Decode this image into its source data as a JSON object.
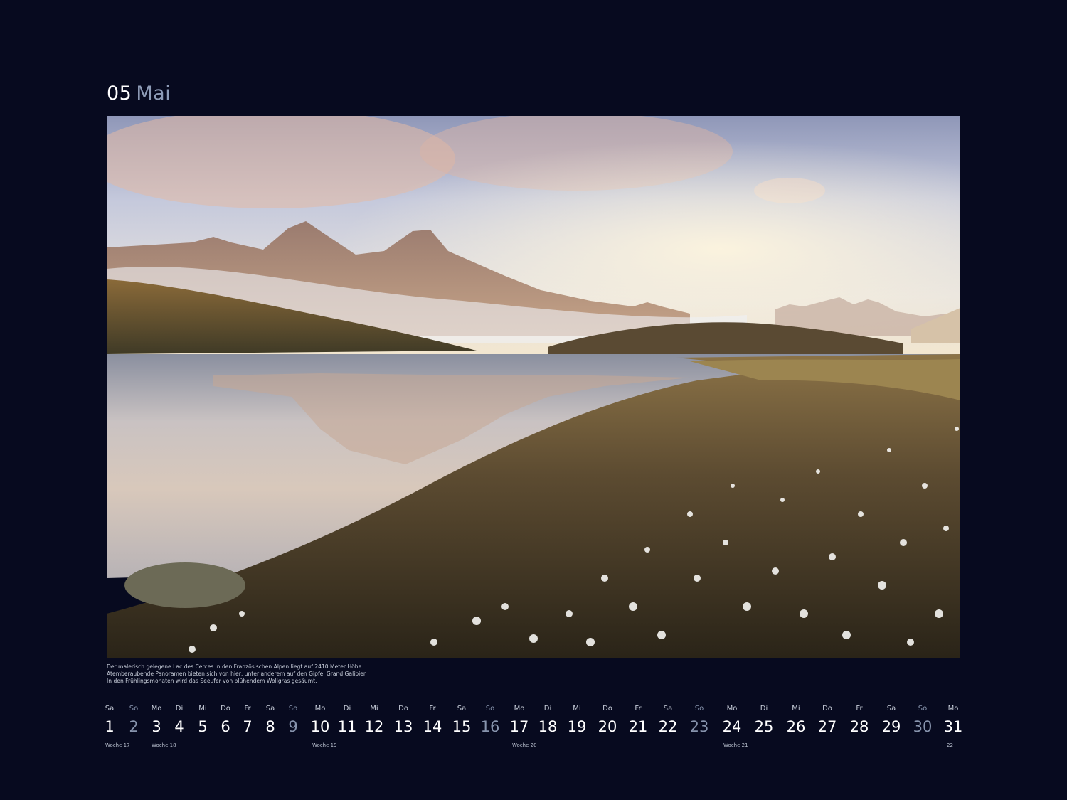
{
  "header": {
    "month_number": "05",
    "month_name": "Mai"
  },
  "photo": {
    "subject": "mountain-lake-landscape"
  },
  "caption": [
    "Der malerisch gelegene Lac des Cerces in den Französischen Alpen liegt auf 2410 Meter Höhe.",
    "Atemberaubende Panoramen bieten sich von hier, unter anderem auf den Gipfel Grand Galibier.",
    "In den Frühlingsmonaten wird das Seeufer von blühendem Wollgras gesäumt."
  ],
  "calendar": {
    "days": [
      {
        "dn": "Sa",
        "d": "1",
        "sun": false
      },
      {
        "dn": "So",
        "d": "2",
        "sun": true
      },
      {
        "dn": "Mo",
        "d": "3",
        "sun": false
      },
      {
        "dn": "Di",
        "d": "4",
        "sun": false
      },
      {
        "dn": "Mi",
        "d": "5",
        "sun": false
      },
      {
        "dn": "Do",
        "d": "6",
        "sun": false
      },
      {
        "dn": "Fr",
        "d": "7",
        "sun": false
      },
      {
        "dn": "Sa",
        "d": "8",
        "sun": false
      },
      {
        "dn": "So",
        "d": "9",
        "sun": true
      },
      {
        "dn": "Mo",
        "d": "10",
        "sun": false
      },
      {
        "dn": "Di",
        "d": "11",
        "sun": false
      },
      {
        "dn": "Mi",
        "d": "12",
        "sun": false
      },
      {
        "dn": "Do",
        "d": "13",
        "sun": false
      },
      {
        "dn": "Fr",
        "d": "14",
        "sun": false
      },
      {
        "dn": "Sa",
        "d": "15",
        "sun": false
      },
      {
        "dn": "So",
        "d": "16",
        "sun": true
      },
      {
        "dn": "Mo",
        "d": "17",
        "sun": false
      },
      {
        "dn": "Di",
        "d": "18",
        "sun": false
      },
      {
        "dn": "Mi",
        "d": "19",
        "sun": false
      },
      {
        "dn": "Do",
        "d": "20",
        "sun": false
      },
      {
        "dn": "Fr",
        "d": "21",
        "sun": false
      },
      {
        "dn": "Sa",
        "d": "22",
        "sun": false
      },
      {
        "dn": "So",
        "d": "23",
        "sun": true
      },
      {
        "dn": "Mo",
        "d": "24",
        "sun": false
      },
      {
        "dn": "Di",
        "d": "25",
        "sun": false
      },
      {
        "dn": "Mi",
        "d": "26",
        "sun": false
      },
      {
        "dn": "Do",
        "d": "27",
        "sun": false
      },
      {
        "dn": "Fr",
        "d": "28",
        "sun": false
      },
      {
        "dn": "Sa",
        "d": "29",
        "sun": false
      },
      {
        "dn": "So",
        "d": "30",
        "sun": true
      },
      {
        "dn": "Mo",
        "d": "31",
        "sun": false
      }
    ],
    "weeks": [
      "Woche 17",
      "Woche 18",
      "Woche 19",
      "Woche 20",
      "Woche 21",
      "22"
    ]
  },
  "colors": {
    "background": "#070a1f",
    "accent": "#8e9cb7",
    "weekend": "#8794ad"
  }
}
